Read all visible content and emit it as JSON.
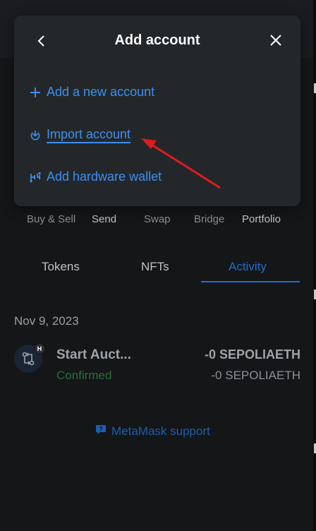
{
  "actions": [
    {
      "label": "Buy & Sell"
    },
    {
      "label": "Send"
    },
    {
      "label": "Swap"
    },
    {
      "label": "Bridge"
    },
    {
      "label": "Portfolio"
    }
  ],
  "tabs": [
    {
      "label": "Tokens"
    },
    {
      "label": "NFTs"
    },
    {
      "label": "Activity",
      "active": true
    }
  ],
  "activity": {
    "date": "Nov 9, 2023",
    "items": [
      {
        "title": "Start Auct...",
        "status": "Confirmed",
        "amount": "-0 SEPOLIAETH",
        "sub_amount": "-0 SEPOLIAETH",
        "badge": "H"
      }
    ]
  },
  "support": {
    "label": "MetaMask support"
  },
  "modal": {
    "title": "Add account",
    "options": [
      {
        "label": "Add a new account",
        "icon": "plus-icon"
      },
      {
        "label": "Import account",
        "icon": "import-icon"
      },
      {
        "label": "Add hardware wallet",
        "icon": "hardware-wallet-icon"
      }
    ]
  },
  "colors": {
    "accent": "#3d8ff0",
    "background": "#141618",
    "modal": "#24272a",
    "success": "#2a6f37",
    "annotation_arrow": "#e01b1b"
  }
}
